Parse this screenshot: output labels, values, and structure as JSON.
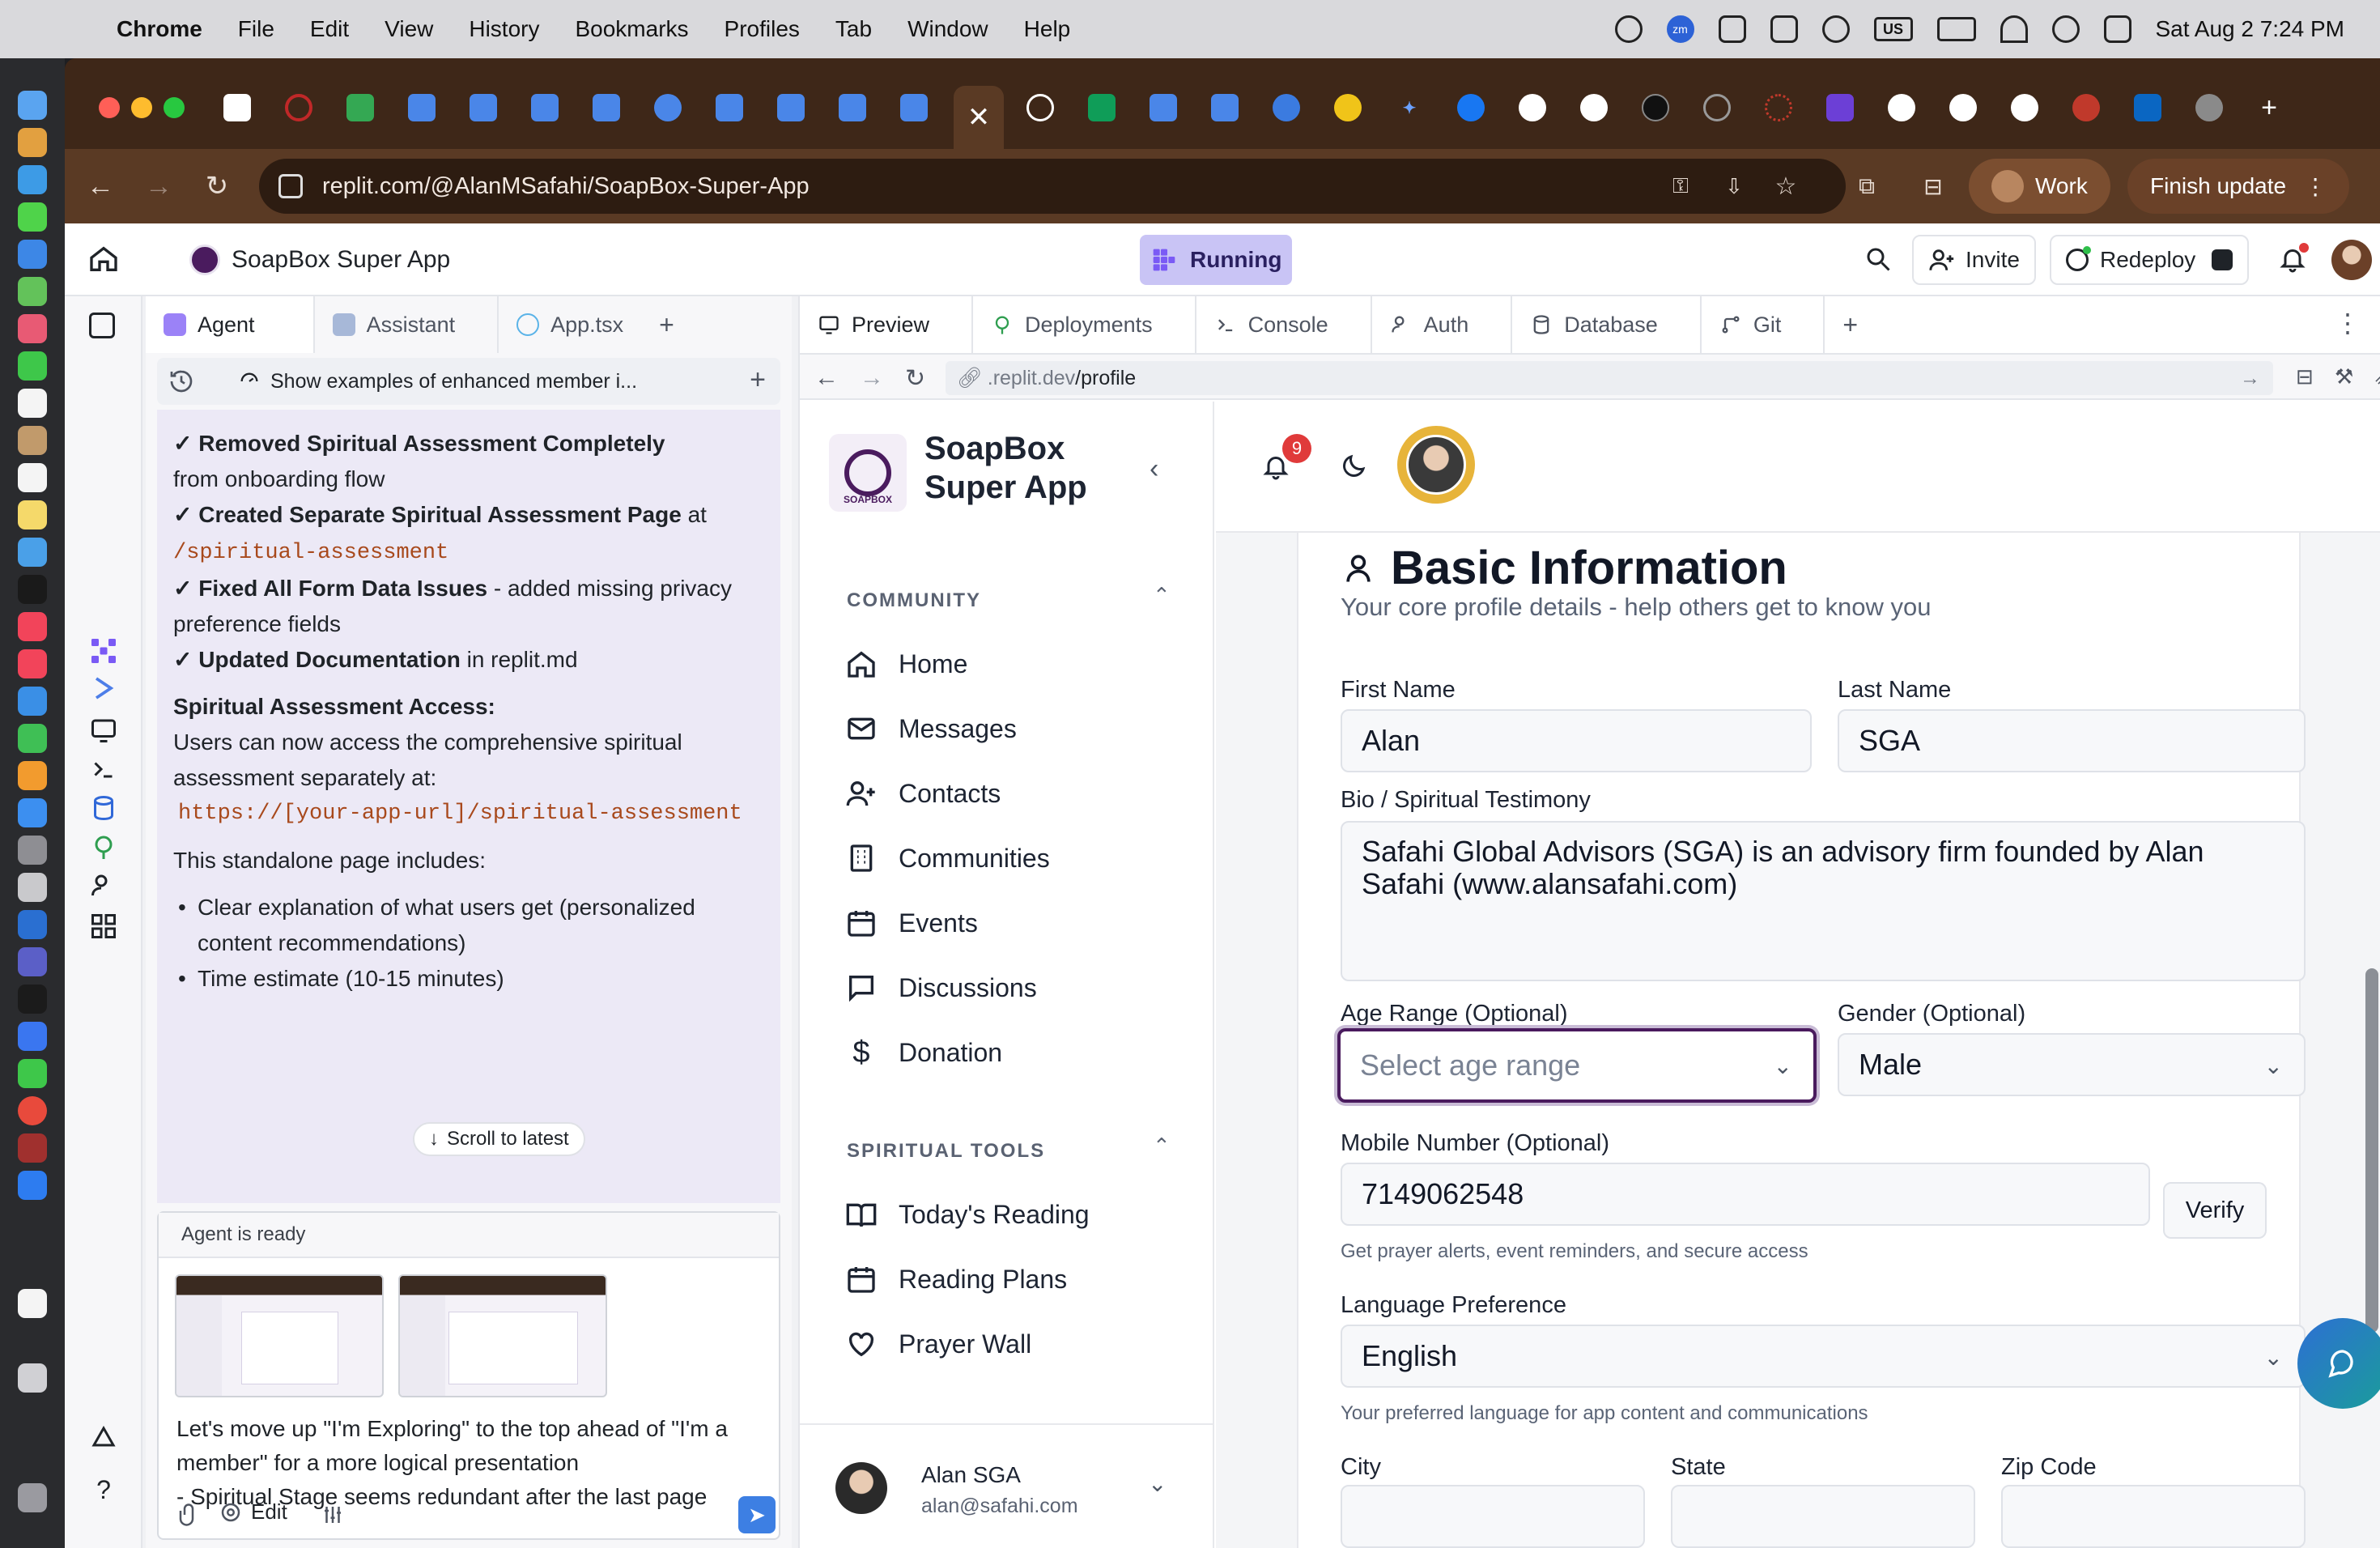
{
  "menubar": {
    "app": "Chrome",
    "items": [
      "File",
      "Edit",
      "View",
      "History",
      "Bookmarks",
      "Profiles",
      "Tab",
      "Window",
      "Help"
    ],
    "zoom_badge": "zm",
    "us_badge": "US",
    "datetime": "Sat Aug 2  7:24 PM"
  },
  "browser": {
    "url": "replit.com/@AlanMSafahi/SoapBox-Super-App",
    "profile_label": "Work",
    "update_label": "Finish update",
    "active_tab_close": "✕",
    "new_tab_glyph": "+"
  },
  "replit": {
    "project_title": "SoapBox Super App",
    "run_status": "Running",
    "invite_label": "Invite",
    "redeploy_label": "Redeploy",
    "left_tabs": [
      {
        "label": "Agent"
      },
      {
        "label": "Assistant"
      },
      {
        "label": "App.tsx"
      }
    ],
    "right_tabs": [
      {
        "label": "Preview"
      },
      {
        "label": "Deployments"
      },
      {
        "label": "Console"
      },
      {
        "label": "Auth"
      },
      {
        "label": "Database"
      },
      {
        "label": "Git"
      }
    ],
    "chat_title": "Show examples of enhanced member i...",
    "chat": {
      "l1_bold": "✓ Removed Spiritual Assessment Completely",
      "l1_rest": "from onboarding flow",
      "l2_bold": "✓ Created Separate Spiritual Assessment Page",
      "l2_rest": " at",
      "l2_code": "/spiritual-assessment",
      "l3_bold": "✓ Fixed All Form Data Issues",
      "l3_rest": " - added missing privacy preference fields",
      "l4_bold": "✓ Updated Documentation",
      "l4_rest": " in replit.md",
      "access_heading": "Spiritual Assessment Access:",
      "access_text": "Users can now access the comprehensive spiritual assessment separately at:",
      "access_code": "https://[your-app-url]/spiritual-assessment",
      "standalone": "This standalone page includes:",
      "bullet1": "Clear explanation of what users get (personalized content recommendations)",
      "bullet2": "Time estimate (10-15 minutes)"
    },
    "scroll_latest": "Scroll to latest",
    "agent_status": "Agent is ready",
    "composer_text": "Let's move up \"I'm Exploring\" to the top ahead of \"I'm a member\" for a more logical presentation\n- Spiritual Stage seems redundant after the last page",
    "edit_label": "Edit",
    "preview_url_prefix": ".replit.dev",
    "preview_url_path": "/profile"
  },
  "app": {
    "name_line1": "SoapBox",
    "name_line2": "Super App",
    "logo_caption": "SOAPBOX",
    "sections": {
      "community": "COMMUNITY",
      "spiritual_tools": "SPIRITUAL TOOLS"
    },
    "community_items": [
      "Home",
      "Messages",
      "Contacts",
      "Communities",
      "Events",
      "Discussions",
      "Donation"
    ],
    "tool_items": [
      "Today's Reading",
      "Reading Plans",
      "Prayer Wall"
    ],
    "user_name": "Alan SGA",
    "user_email": "alan@safahi.com",
    "notification_count": "9"
  },
  "form": {
    "title": "Basic Information",
    "subtitle": "Your core profile details - help others get to know you",
    "first_name_label": "First Name",
    "first_name": "Alan",
    "last_name_label": "Last Name",
    "last_name": "SGA",
    "bio_label": "Bio / Spiritual Testimony",
    "bio": "Safahi Global Advisors (SGA) is an advisory firm founded by Alan Safahi (www.alansafahi.com)",
    "age_label": "Age Range (Optional)",
    "age_placeholder": "Select age range",
    "gender_label": "Gender (Optional)",
    "gender": "Male",
    "mobile_label": "Mobile Number (Optional)",
    "mobile": "7149062548",
    "verify_label": "Verify",
    "mobile_help": "Get prayer alerts, event reminders, and secure access",
    "language_label": "Language Preference",
    "language": "English",
    "language_help": "Your preferred language for app content and communications",
    "city_label": "City",
    "state_label": "State",
    "zip_label": "Zip Code"
  }
}
